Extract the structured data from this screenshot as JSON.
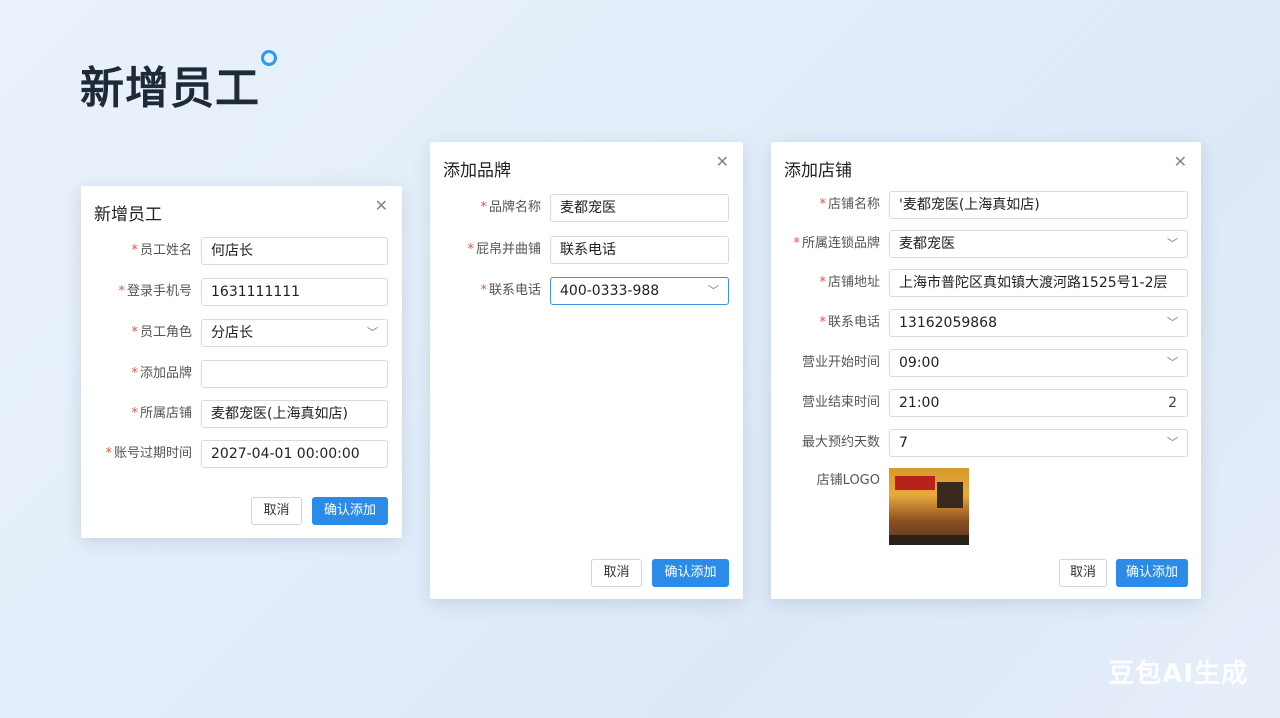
{
  "page": {
    "title": "新增员工",
    "watermark": "豆包AI生成"
  },
  "buttons": {
    "cancel": "取消",
    "confirm": "确认添加"
  },
  "dialogs": {
    "employee": {
      "title": "新增员工",
      "fields": [
        {
          "label": "员工姓名",
          "required": "*",
          "value": "何店长"
        },
        {
          "label": "登录手机号",
          "required": "*",
          "value": "1631111111"
        },
        {
          "label": "员工角色",
          "required": "*",
          "value": "分店长"
        },
        {
          "label": "添加品牌",
          "required": "*",
          "value": ""
        },
        {
          "label": "所属店铺",
          "required": "*",
          "value": "麦都宠医(上海真如店)"
        },
        {
          "label": "账号过期时间",
          "required": "*",
          "value": "2027-04-01 00:00:00"
        }
      ]
    },
    "brand": {
      "title": "添加品牌",
      "fields": [
        {
          "label": "品牌名称",
          "required": "*",
          "value": "麦都宠医"
        },
        {
          "label": "屁帛并曲铺",
          "required": "*",
          "value": "联系电话"
        },
        {
          "label": "联系电话",
          "required": "*",
          "value": "400-0333-988"
        }
      ]
    },
    "store": {
      "title": "添加店铺",
      "fields": [
        {
          "label": "店铺名称",
          "required": "*",
          "value": "'麦都宠医(上海真如店)"
        },
        {
          "label": "所属连锁品牌",
          "required": "*",
          "value": "麦都宠医"
        },
        {
          "label": "店铺地址",
          "required": "*",
          "value": "上海市普陀区真如镇大渡河路1525号1-2层"
        },
        {
          "label": "联系电话",
          "required": "*",
          "value": "13162059868"
        },
        {
          "label": "营业开始时间",
          "required": "",
          "value": "09:00"
        },
        {
          "label": "营业结束时间",
          "required": "",
          "value": "21:00",
          "suffix": "2"
        },
        {
          "label": "最大预约天数",
          "required": "",
          "value": "7"
        }
      ],
      "logo_label": "店铺LOGO"
    }
  },
  "icons": {
    "close": "close-icon",
    "chevron": "chevron-down-icon"
  },
  "colors": {
    "primary": "#2b8be8",
    "required": "#e5534b",
    "accent_ring": "#2b9af0"
  }
}
